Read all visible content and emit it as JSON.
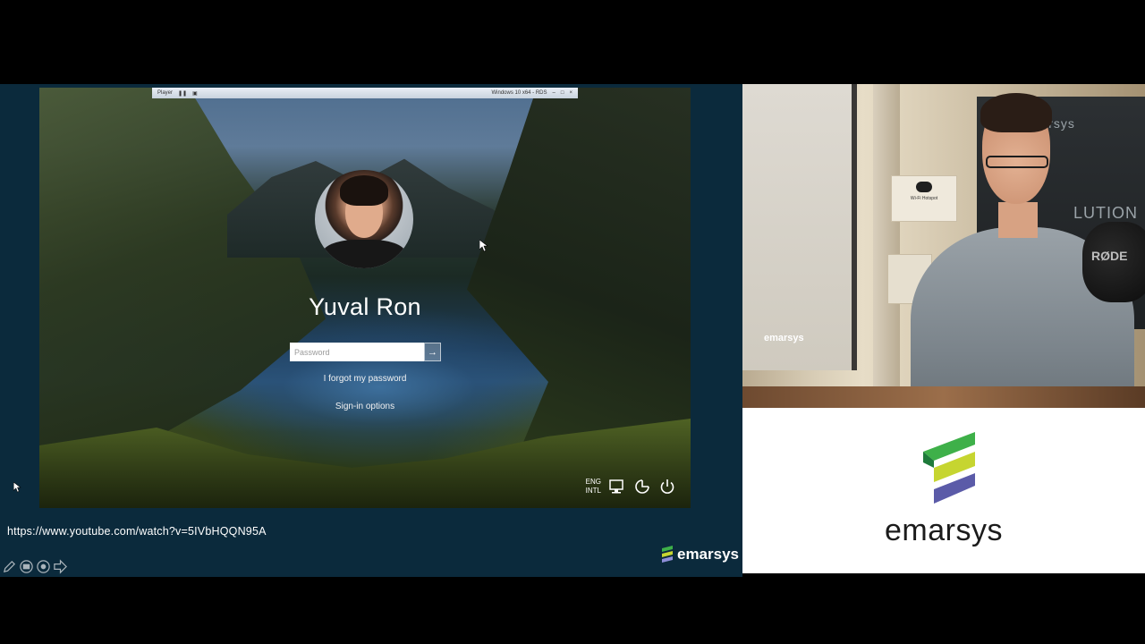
{
  "lockscreen": {
    "toolbar_left": "Player",
    "toolbar_right": "Windows 10 x64 - RDS",
    "user_name": "Yuval Ron",
    "password_placeholder": "Password",
    "submit_glyph": "→",
    "forgot_password": "I forgot my password",
    "signin_options": "Sign-in options",
    "lang_line1": "ENG",
    "lang_line2": "INTL",
    "tray_icons": [
      "network-icon",
      "ease-of-access-icon",
      "power-icon"
    ]
  },
  "slide": {
    "url": "https://www.youtube.com/watch?v=5IVbHQQN95A",
    "logo_text": "emarsys",
    "nav_icons": [
      "pen-icon",
      "slides-icon",
      "zoom-icon",
      "next-arrow-icon"
    ]
  },
  "camera": {
    "projector_logo": "emarsys",
    "banner_top": "emarsys",
    "banner_bottom": "LUTION",
    "mic_label": "RØDE",
    "sign_title": "Wi-Fi Hotspot"
  },
  "brand": {
    "word": "emarsys",
    "colors": {
      "green": "#3eb049",
      "lime": "#c6d530",
      "purple": "#5b5ba8",
      "dark_green": "#1e7a3a"
    }
  }
}
